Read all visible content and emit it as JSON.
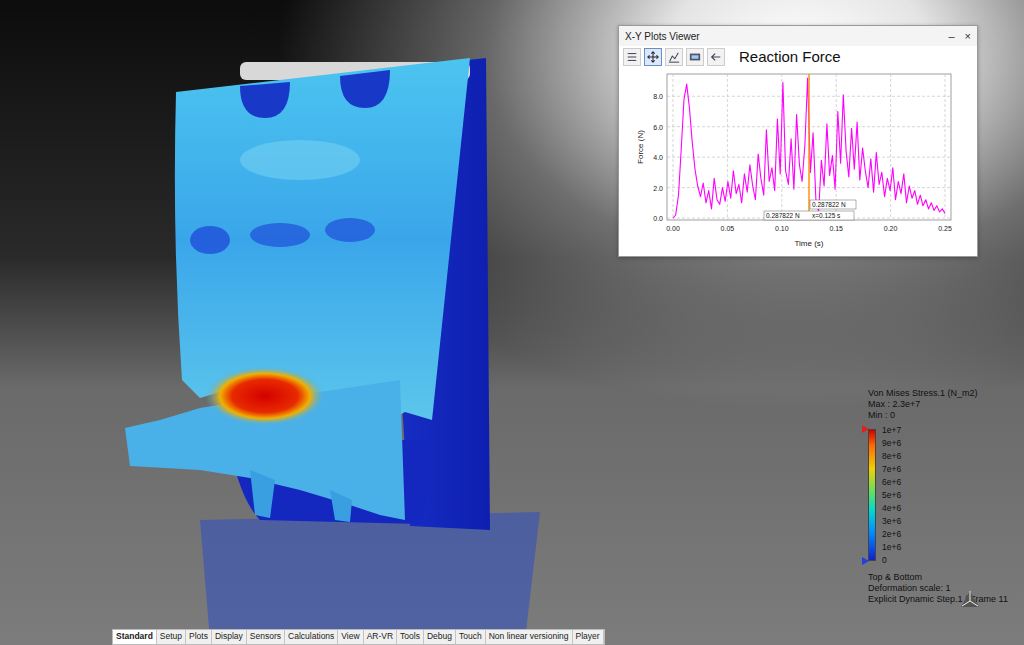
{
  "plot_window": {
    "title": "X-Y Plots Viewer",
    "controls": [
      "–",
      "×"
    ],
    "toolbar": [
      {
        "selected": false
      },
      {
        "selected": true
      },
      {
        "selected": false
      },
      {
        "selected": false
      },
      {
        "selected": false
      }
    ],
    "chart": {
      "title": "Reaction Force",
      "y_label": "Force (N)",
      "x_label": "Time (s)",
      "y_ticks": [
        "0.0",
        "2.0",
        "4.0",
        "6.0",
        "8.0"
      ],
      "x_ticks": [
        "0.00",
        "0.05",
        "0.10",
        "0.15",
        "0.20",
        "0.25"
      ],
      "series": [
        {
          "name": "Reaction Force",
          "color": "#ff00ff",
          "values": [
            0,
            0.2,
            1.5,
            4.5,
            7.8,
            8.8,
            7.2,
            5.0,
            3.2,
            2.1,
            1.4,
            2.3,
            1.0,
            1.8,
            0.6,
            2.6,
            1.2,
            0.9,
            2.0,
            1.1,
            2.4,
            1.3,
            3.1,
            1.6,
            2.2,
            1.0,
            2.9,
            1.7,
            3.5,
            2.1,
            1.2,
            4.2,
            2.6,
            1.5,
            5.8,
            2.4,
            3.3,
            1.8,
            6.5,
            2.9,
            8.9,
            3.1,
            2.2,
            5.2,
            1.9,
            6.8,
            3.5,
            2.4,
            4.8,
            9.2,
            3.0,
            5.6,
            1.2,
            0.4,
            3.8,
            2.1,
            6.2,
            2.8,
            4.1,
            1.9,
            7.0,
            3.6,
            8.1,
            4.4,
            2.7,
            5.9,
            3.2,
            6.3,
            2.5,
            4.6,
            3.1,
            2.0,
            3.9,
            1.7,
            4.3,
            2.2,
            3.0,
            1.4,
            2.6,
            1.8,
            3.3,
            1.2,
            2.4,
            1.6,
            2.9,
            1.0,
            2.1,
            1.3,
            1.8,
            0.9,
            1.5,
            0.8,
            1.2,
            0.6,
            1.0,
            0.5,
            0.8,
            0.4,
            0.6,
            0.3
          ]
        }
      ],
      "cursor": {
        "x": 0.125,
        "value": 0.287822,
        "label": "0.287822 N",
        "readout_value": "0.287822 N",
        "readout_x": "x=0.125 s"
      }
    }
  },
  "legend": {
    "title": "Von Mises Stress.1 (N_m2)",
    "max": "Max : 2.3e+7",
    "min": "Min : 0",
    "ticks": [
      "1e+7",
      "9e+6",
      "8e+6",
      "7e+6",
      "6e+6",
      "5e+6",
      "4e+6",
      "3e+6",
      "2e+6",
      "1e+6",
      "0"
    ],
    "footer": [
      "Top & Bottom",
      "Deformation scale: 1",
      "Explicit Dynamic Step.1 / Frame 11"
    ]
  },
  "tabs": [
    {
      "label": "Standard",
      "selected": true
    },
    {
      "label": "Setup",
      "selected": false
    },
    {
      "label": "Plots",
      "selected": false
    },
    {
      "label": "Display",
      "selected": false
    },
    {
      "label": "Sensors",
      "selected": false
    },
    {
      "label": "Calculations",
      "selected": false
    },
    {
      "label": "View",
      "selected": false
    },
    {
      "label": "AR-VR",
      "selected": false
    },
    {
      "label": "Tools",
      "selected": false
    },
    {
      "label": "Debug",
      "selected": false
    },
    {
      "label": "Touch",
      "selected": false
    },
    {
      "label": "Non linear versioning",
      "selected": false
    },
    {
      "label": "Player",
      "selected": false
    }
  ]
}
